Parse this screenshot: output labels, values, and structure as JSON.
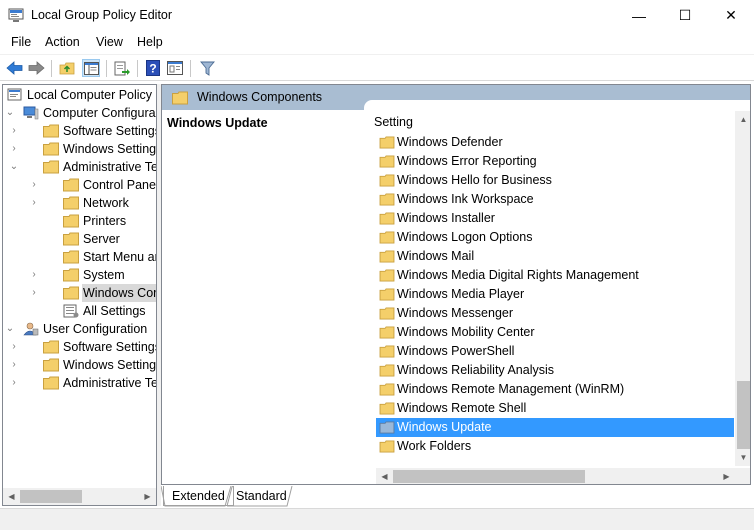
{
  "window": {
    "title": "Local Group Policy Editor",
    "controls": {
      "minimize": "—",
      "maximize": "☐",
      "close": "✕"
    }
  },
  "menu": [
    "File",
    "Action",
    "View",
    "Help"
  ],
  "toolbar": {
    "icons": [
      "back-arrow-icon",
      "forward-arrow-icon",
      "up-folder-icon",
      "show-hide-tree-icon",
      "export-list-icon",
      "help-icon",
      "properties-pane-icon",
      "filter-icon"
    ]
  },
  "tree": [
    {
      "label": "Local Computer Policy",
      "icon": "computer-policy-icon",
      "expander": ""
    },
    {
      "label": "Computer Configura",
      "icon": "computer-icon",
      "expander": "⌄"
    },
    {
      "label": "Software Settings",
      "icon": "folder-icon",
      "expander": "›"
    },
    {
      "label": "Windows Settings",
      "icon": "folder-icon",
      "expander": "›"
    },
    {
      "label": "Administrative Te",
      "icon": "folder-icon",
      "expander": "⌄"
    },
    {
      "label": "Control Panel",
      "icon": "folder-icon",
      "expander": "›"
    },
    {
      "label": "Network",
      "icon": "folder-icon",
      "expander": "›"
    },
    {
      "label": "Printers",
      "icon": "folder-icon",
      "expander": ""
    },
    {
      "label": "Server",
      "icon": "folder-icon",
      "expander": ""
    },
    {
      "label": "Start Menu ar",
      "icon": "folder-icon",
      "expander": ""
    },
    {
      "label": "System",
      "icon": "folder-icon",
      "expander": "›"
    },
    {
      "label": "Windows Cor",
      "icon": "folder-icon",
      "expander": "›",
      "selected": true
    },
    {
      "label": "All Settings",
      "icon": "settings-list-icon",
      "expander": ""
    },
    {
      "label": "User Configuration",
      "icon": "user-icon",
      "expander": "⌄"
    },
    {
      "label": "Software Settings",
      "icon": "folder-icon",
      "expander": "›"
    },
    {
      "label": "Windows Settings",
      "icon": "folder-icon",
      "expander": "›"
    },
    {
      "label": "Administrative Te",
      "icon": "folder-icon",
      "expander": "›"
    }
  ],
  "details": {
    "header": "Windows Components",
    "title": "Windows Update",
    "column": "Setting",
    "items": [
      {
        "label": "Windows Defender"
      },
      {
        "label": "Windows Error Reporting"
      },
      {
        "label": "Windows Hello for Business"
      },
      {
        "label": "Windows Ink Workspace"
      },
      {
        "label": "Windows Installer"
      },
      {
        "label": "Windows Logon Options"
      },
      {
        "label": "Windows Mail"
      },
      {
        "label": "Windows Media Digital Rights Management"
      },
      {
        "label": "Windows Media Player"
      },
      {
        "label": "Windows Messenger"
      },
      {
        "label": "Windows Mobility Center"
      },
      {
        "label": "Windows PowerShell"
      },
      {
        "label": "Windows Reliability Analysis"
      },
      {
        "label": "Windows Remote Management (WinRM)"
      },
      {
        "label": "Windows Remote Shell"
      },
      {
        "label": "Windows Update",
        "selected": true
      },
      {
        "label": "Work Folders"
      }
    ]
  },
  "tabs": [
    {
      "label": "Extended",
      "active": true
    },
    {
      "label": "Standard",
      "active": false
    }
  ],
  "colors": {
    "header_band": "#a9bdd2",
    "selection": "#3399ff",
    "folder": "#f4cf6a"
  }
}
